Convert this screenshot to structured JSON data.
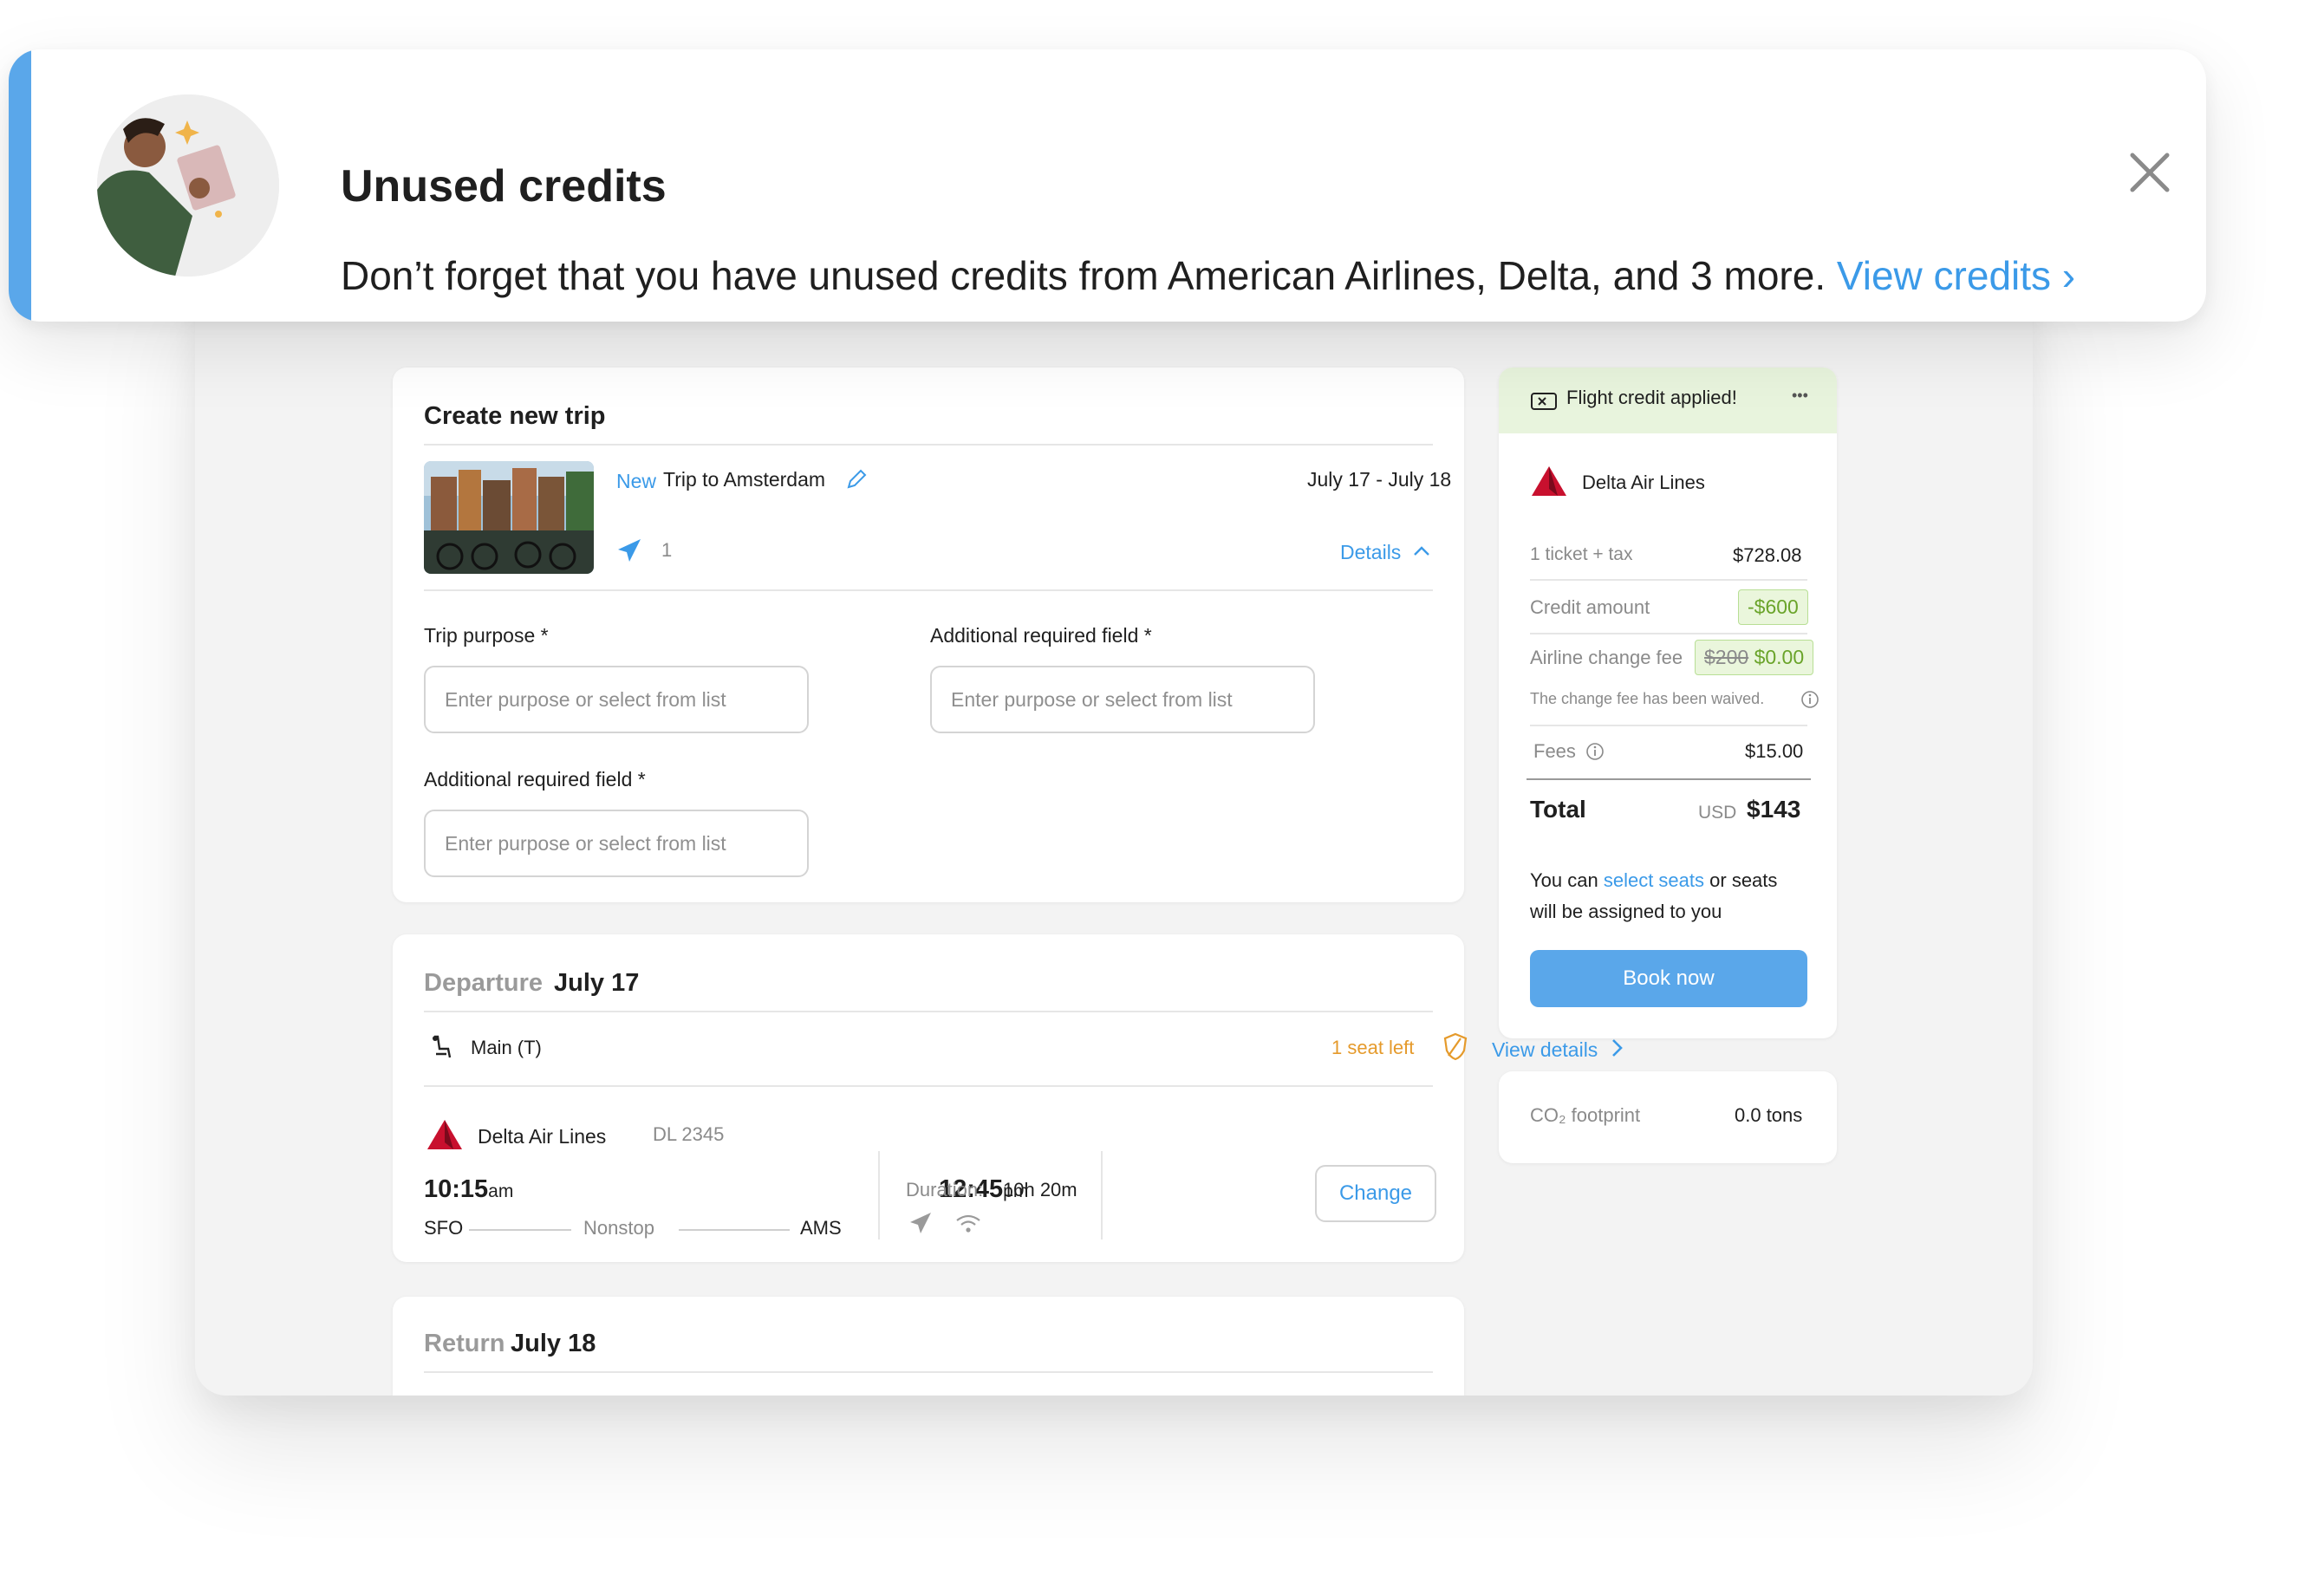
{
  "banner": {
    "title": "Unused credits",
    "message": "Don’t forget that you have unused credits from American Airlines, Delta, and 3 more.",
    "link": "View credits ›"
  },
  "trip": {
    "card_title": "Create new trip",
    "new_tag": "New",
    "name": "Trip to Amsterdam",
    "dates": "July 17 - July 18",
    "travelers": "1",
    "details_link": "Details",
    "fields": [
      {
        "label": "Trip purpose *",
        "placeholder": "Enter purpose or select from list"
      },
      {
        "label": "Additional required field *",
        "placeholder": "Enter purpose or select from list"
      },
      {
        "label": "Additional required field *",
        "placeholder": "Enter purpose or select from list"
      }
    ]
  },
  "departure": {
    "label": "Departure",
    "date": "July 17",
    "cabin": "Main (T)",
    "seats_left": "1 seat left",
    "view_details": "View details",
    "airline": "Delta Air Lines",
    "flight_no": "DL 2345",
    "depart_time": "10:15",
    "depart_ampm": "am",
    "arrive_time": "12:45",
    "arrive_ampm": "pm",
    "origin": "SFO",
    "destination": "AMS",
    "stops": "Nonstop",
    "duration_label": "Duration:",
    "duration": "10h 20m",
    "change_button": "Change"
  },
  "return": {
    "label": "Return",
    "date": "July 18"
  },
  "summary": {
    "header": "Flight credit applied!",
    "more": "•••",
    "airline": "Delta Air Lines",
    "rows": {
      "ticket_label": "1 ticket + tax",
      "ticket_value": "$728.08",
      "credit_label": "Credit amount",
      "credit_value": "-$600",
      "change_fee_label": "Airline change fee",
      "change_fee_old": "$200",
      "change_fee_new": "$0.00",
      "waived_note": "The change fee has been waived.",
      "fees_label": "Fees",
      "fees_value": "$15.00"
    },
    "total_label": "Total",
    "currency": "USD",
    "total_value": "$143",
    "seats_prefix": "You can",
    "seats_link": "select seats",
    "seats_suffix_1": "or seats",
    "seats_suffix_2": "will be assigned to you",
    "book_button": "Book now"
  },
  "co2": {
    "label": "CO₂ footprint",
    "value": "0.0 tons"
  },
  "colors": {
    "accent": "#5aa7ea",
    "link": "#3b9ae8",
    "warning": "#e59a2b",
    "credit_green": "#6aa42a",
    "delta_red": "#c8102e"
  }
}
